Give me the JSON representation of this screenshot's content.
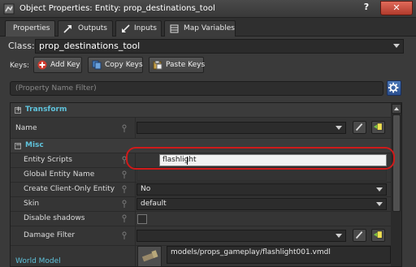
{
  "window": {
    "title": "Object Properties: Entity: prop_destinations_tool",
    "help_label": "?",
    "close_label": "✕"
  },
  "tabs": [
    {
      "label": "Properties",
      "active": true,
      "icon": ""
    },
    {
      "label": "Outputs",
      "active": false,
      "icon": "outputs-arrow-icon"
    },
    {
      "label": "Inputs",
      "active": false,
      "icon": "inputs-arrow-icon"
    },
    {
      "label": "Map Variables",
      "active": false,
      "icon": "map-variables-icon"
    }
  ],
  "class": {
    "label": "Class:",
    "value": "prop_destinations_tool"
  },
  "keys": {
    "label": "Keys:",
    "add_label": "Add Key",
    "copy_label": "Copy Keys",
    "paste_label": "Paste Keys"
  },
  "filter": {
    "placeholder": "(Property Name Filter)"
  },
  "groups": {
    "transform": "Transform",
    "misc": "Misc"
  },
  "properties": {
    "name": {
      "label": "Name",
      "value": ""
    },
    "entity_scripts": {
      "label": "Entity Scripts",
      "value": "flashlight"
    },
    "global_entity_name": {
      "label": "Global Entity Name",
      "value": ""
    },
    "create_client_only": {
      "label": "Create Client-Only Entity",
      "value": "No"
    },
    "skin": {
      "label": "Skin",
      "value": "default"
    },
    "disable_shadows": {
      "label": "Disable shadows",
      "checked": false
    },
    "damage_filter": {
      "label": "Damage Filter",
      "value": ""
    },
    "world_model": {
      "label": "World Model",
      "value": "models/props_gameplay/flashlight001.vmdl"
    }
  },
  "colors": {
    "group_text": "#5fc3dc",
    "highlight": "#d01a1a",
    "close_button": "#c4483a"
  }
}
